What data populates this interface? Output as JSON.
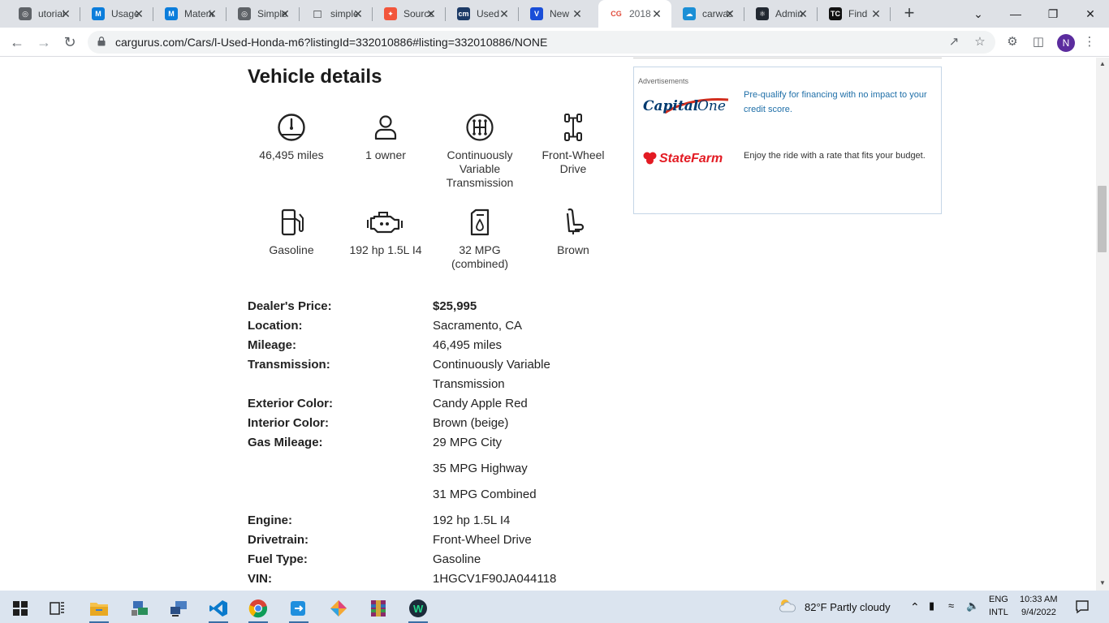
{
  "browser": {
    "tabs": [
      {
        "title": "utorial",
        "favicon": "globe-icon",
        "color": "#5f6368",
        "active": false
      },
      {
        "title": "Usage",
        "favicon": "mui-icon",
        "color": "#0b7ddb",
        "active": false
      },
      {
        "title": "Material",
        "favicon": "mui-icon",
        "color": "#0b7ddb",
        "active": false
      },
      {
        "title": "Simple",
        "favicon": "globe-icon",
        "color": "#5f6368",
        "active": false
      },
      {
        "title": "simple",
        "favicon": "square-icon",
        "color": "#202124",
        "active": false
      },
      {
        "title": "Source",
        "favicon": "sourcegraph-icon",
        "color": "#f2553b",
        "active": false
      },
      {
        "title": "Used",
        "favicon": "cm-icon",
        "color": "#1c3a66",
        "active": false
      },
      {
        "title": "New",
        "favicon": "v-icon",
        "color": "#1a4ed8",
        "active": false
      },
      {
        "title": "2018",
        "favicon": "cargurus-icon",
        "color": "#e14b3b",
        "active": true
      },
      {
        "title": "carwash",
        "favicon": "cloud-icon",
        "color": "#1b8fd6",
        "active": false
      },
      {
        "title": "Admin",
        "favicon": "react-icon",
        "color": "#222831",
        "active": false
      },
      {
        "title": "Find",
        "favicon": "tc-icon",
        "color": "#111111",
        "active": false
      }
    ],
    "url": "cargurus.com/Cars/l-Used-Honda-m6?listingId=332010886#listing=332010886/NONE",
    "profile_initial": "N",
    "accent": "#1a73e8"
  },
  "page": {
    "section_title": "Vehicle details",
    "features": [
      {
        "icon": "speedometer-icon",
        "label": "46,495 miles"
      },
      {
        "icon": "owner-icon",
        "label": "1 owner"
      },
      {
        "icon": "transmission-icon",
        "label": "Continuously Variable Transmission"
      },
      {
        "icon": "drivetrain-icon",
        "label": "Front-Wheel Drive"
      },
      {
        "icon": "fuel-pump-icon",
        "label": "Gasoline"
      },
      {
        "icon": "engine-icon",
        "label": "192 hp 1.5L I4"
      },
      {
        "icon": "fuel-can-icon",
        "label": "32 MPG (combined)"
      },
      {
        "icon": "seat-icon",
        "label": "Brown"
      }
    ],
    "details": [
      {
        "label": "Dealer's Price:",
        "value": "$25,995"
      },
      {
        "label": "Location:",
        "value": "Sacramento, CA"
      },
      {
        "label": "Mileage:",
        "value": "46,495 miles"
      },
      {
        "label": "Transmission:",
        "value": "Continuously Variable Transmission"
      },
      {
        "label": "Exterior Color:",
        "value": "Candy Apple Red"
      },
      {
        "label": "Interior Color:",
        "value": "Brown (beige)"
      },
      {
        "label": "Gas Mileage:",
        "value": "29 MPG City"
      },
      {
        "label": "",
        "value": "35 MPG Highway"
      },
      {
        "label": "",
        "value": "31 MPG Combined"
      },
      {
        "label": "Engine:",
        "value": "192 hp 1.5L I4"
      },
      {
        "label": "Drivetrain:",
        "value": "Front-Wheel Drive"
      },
      {
        "label": "Fuel Type:",
        "value": "Gasoline"
      },
      {
        "label": "VIN:",
        "value": "1HGCV1F90JA044118"
      }
    ],
    "ads": {
      "label": "Advertisements",
      "items": [
        {
          "logo": "Capital One",
          "text": "Pre-qualify for financing with no impact to your credit score.",
          "color": "#1f6fa8"
        },
        {
          "logo": "State Farm",
          "text": "Enjoy the ride with a rate that fits your budget.",
          "color": "#333333"
        }
      ]
    }
  },
  "taskbar": {
    "weather": "82°F  Partly cloudy",
    "lang_top": "ENG",
    "lang_bottom": "INTL",
    "time": "10:33 AM",
    "date": "9/4/2022"
  }
}
